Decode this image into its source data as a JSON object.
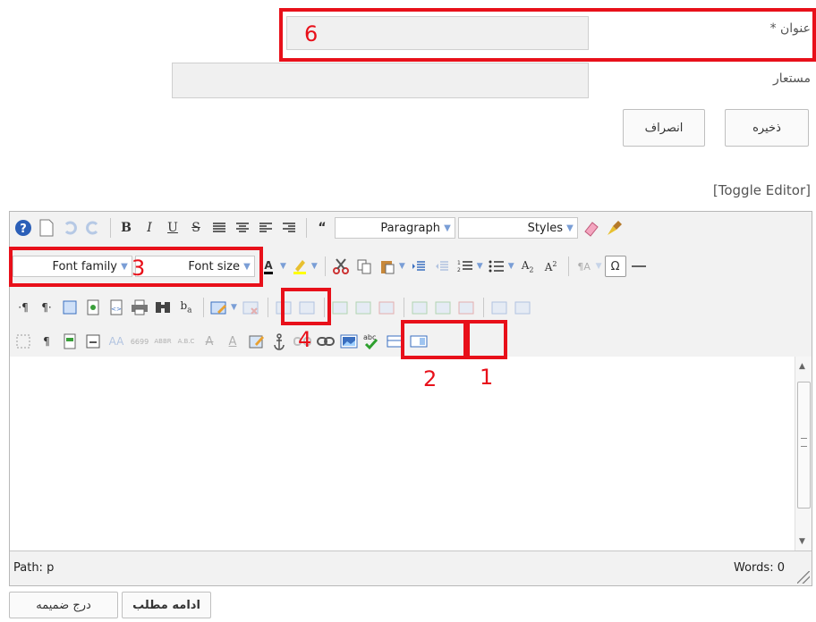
{
  "form": {
    "title_label": "عنوان *",
    "alias_label": "مستعار",
    "save_label": "ذخیره",
    "cancel_label": "انصراف",
    "toggle_editor": "[Toggle Editor]"
  },
  "toolbar": {
    "format_select": "Paragraph",
    "styles_select": "Styles",
    "font_family_select": "Font family",
    "font_size_select": "Font size"
  },
  "statusbar": {
    "path": "Path: p",
    "words": "Words: 0"
  },
  "bottom_buttons": {
    "read_more": "ادامه مطلب",
    "insert_attachment": "درج ضمیمه"
  },
  "annotations": {
    "n1": "1",
    "n2": "2",
    "n3": "3",
    "n4": "4",
    "n6": "6"
  },
  "colors": {
    "annotation_red": "#e8101a"
  }
}
